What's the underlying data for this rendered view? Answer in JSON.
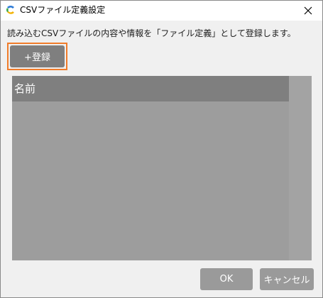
{
  "window": {
    "title": "CSVファイル定義設定",
    "app_icon": "app-logo-icon",
    "close_icon": "close-icon"
  },
  "main": {
    "description": "読み込むCSVファイルの内容や情報を「ファイル定義」として登録します。",
    "register_label": "+登録",
    "list_header": "名前"
  },
  "footer": {
    "ok_label": "OK",
    "cancel_label": "キャンセル"
  },
  "colors": {
    "highlight_border": "#f07c2a",
    "button_gray": "#7f7f7f",
    "list_bg": "#9d9d9d"
  }
}
